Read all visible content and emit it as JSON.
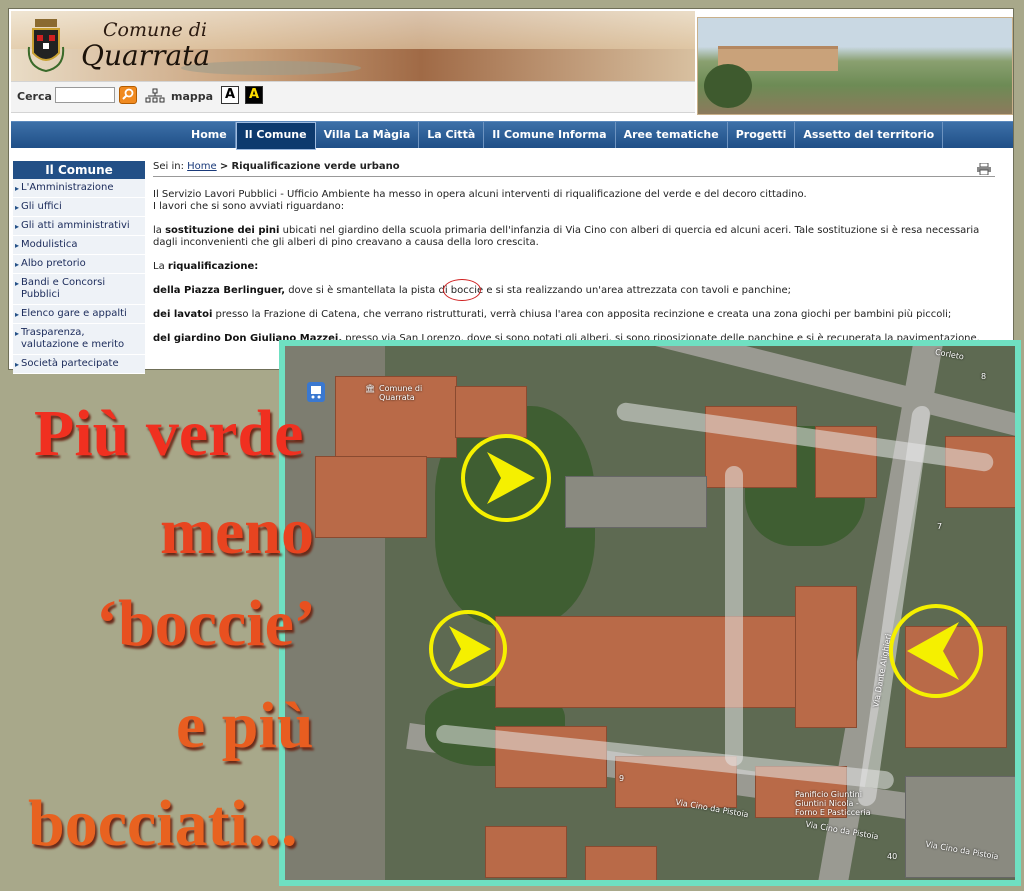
{
  "header": {
    "logo_line1": "Comune di",
    "logo_line2": "Quarrata"
  },
  "toolbar": {
    "search_label": "Cerca",
    "search_value": "",
    "map_label": "mappa",
    "font_size_label": "A",
    "contrast_label": "A"
  },
  "nav": {
    "items": [
      "Home",
      "Il Comune",
      "Villa La Màgia",
      "La Città",
      "Il Comune Informa",
      "Aree tematiche",
      "Progetti",
      "Assetto del territorio"
    ],
    "active": "Il Comune"
  },
  "sidebar": {
    "title": "Il Comune",
    "items": [
      "L'Amministrazione",
      "Gli uffici",
      "Gli atti amministrativi",
      "Modulistica",
      "Albo pretorio",
      "Bandi e Concorsi Pubblici",
      "Elenco gare e appalti",
      "Trasparenza, valutazione e merito",
      "Società partecipate"
    ]
  },
  "breadcrumb": {
    "prefix": "Sei in:",
    "home": "Home",
    "separator": ">",
    "current": "Riqualificazione verde urbano"
  },
  "article": {
    "intro_line1": "Il Servizio Lavori Pubblici - Ufficio Ambiente ha messo in opera alcuni interventi di riqualificazione del verde e del decoro cittadino.",
    "intro_line2": "I lavori che si sono avviati riguardano:",
    "p1_pre": "la ",
    "p1_bold": "sostituzione dei pini",
    "p1_rest": " ubicati nel giardino della scuola primaria dell'infanzia di Via Cino con alberi di quercia ed alcuni aceri. Tale sostituzione si è resa necessaria dagli inconvenienti che gli alberi di pino creavano a causa della loro crescita.",
    "p2_pre": "La ",
    "p2_bold": "riqualificazione:",
    "p3_bold": "della Piazza Berlinguer,",
    "p3_rest": " dove si è smantellata la pista di boccie e si sta realizzando un'area attrezzata con tavoli e panchine;",
    "p4_bold": "dei lavatoi",
    "p4_rest": " presso la Frazione di Catena, che verrano ristrutturati, verrà chiusa l'area con apposita recinzione e  creata  una zona giochi per bambini più piccoli;",
    "p5_bold": "del giardino Don Giuliano Mazzei,",
    "p5_rest": " presso via San Lorenzo, dove si sono potati gli alberi, si sono riposizionate delle panchine e si è recuperata la pavimentazione."
  },
  "map": {
    "label_comune": "Comune di Quarrata",
    "label_panificio": "Panificio Giuntini Giuntini Nicola - Forno E Pasticceria",
    "street_cino_1": "Via Cino da Pistoia",
    "street_cino_2": "Via Cino da Pistoia",
    "street_cino_3": "Via Cino da Pistoia",
    "street_dante": "Via Dante Alighieri",
    "street_top": "Corleto",
    "num_8": "8",
    "num_7": "7",
    "num_9": "9",
    "num_40": "40"
  },
  "slogan": {
    "line1": "Più verde",
    "line2": "meno",
    "line3": "‘boccie’",
    "line4": "e più",
    "line5": "bocciati..."
  },
  "colors": {
    "nav_blue": "#1f4f87",
    "map_border": "#6fe0c2",
    "marker_yellow": "#f5f000",
    "slogan_red": "#e8241a"
  }
}
